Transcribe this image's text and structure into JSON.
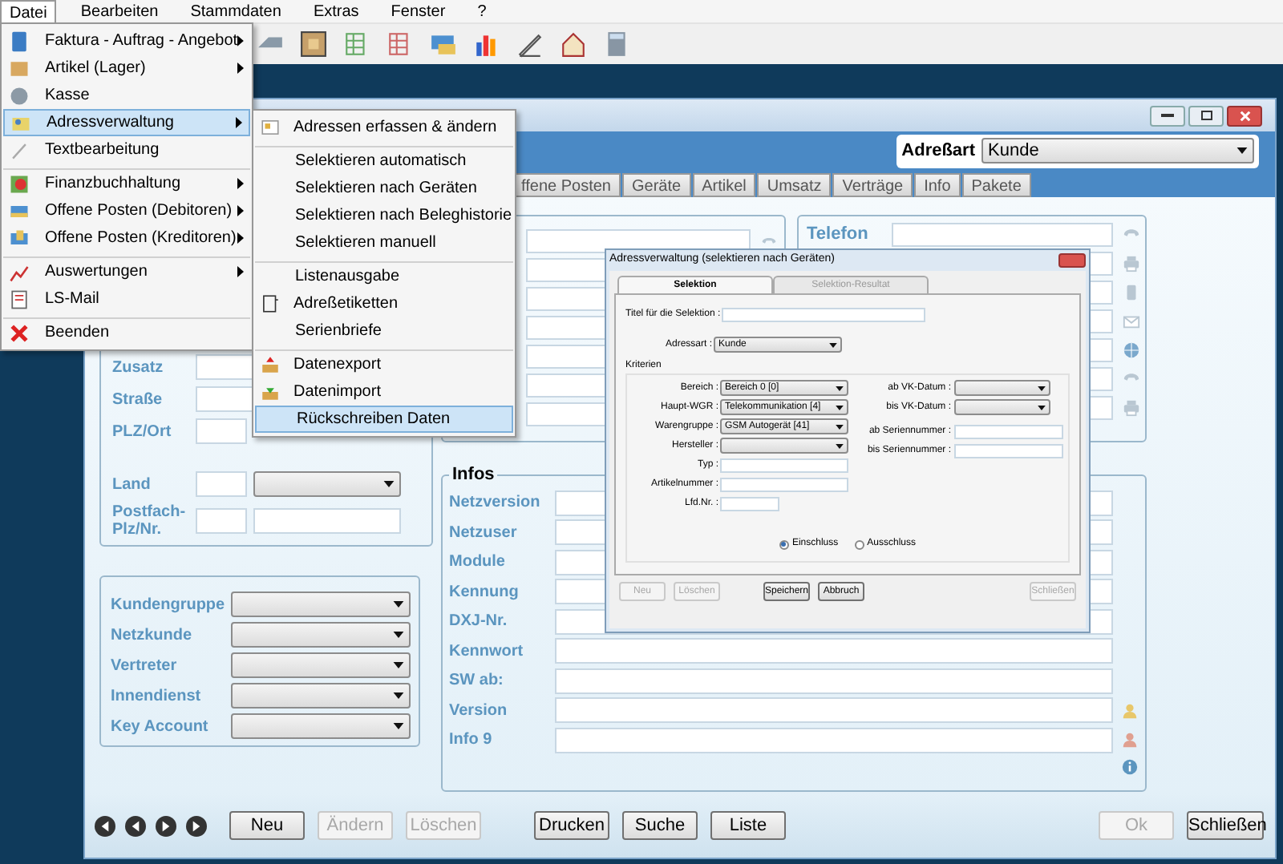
{
  "menubar": [
    {
      "label": "Datei",
      "selected": true
    },
    {
      "label": "Bearbeiten",
      "selected": false
    },
    {
      "label": "Stammdaten",
      "selected": false
    },
    {
      "label": "Extras",
      "selected": false
    },
    {
      "label": "Fenster",
      "selected": false
    },
    {
      "label": "?",
      "selected": false
    }
  ],
  "file_menu": [
    {
      "label": "Faktura - Auftrag - Angebot",
      "submenu": true,
      "selected": false,
      "separator_after": false
    },
    {
      "label": "Artikel (Lager)",
      "submenu": true,
      "selected": false,
      "separator_after": false
    },
    {
      "label": "Kasse",
      "submenu": false,
      "selected": false,
      "separator_after": false
    },
    {
      "label": "Adressverwaltung",
      "submenu": true,
      "selected": true,
      "separator_after": false
    },
    {
      "label": "Textbearbeitung",
      "submenu": false,
      "selected": false,
      "separator_after": true
    },
    {
      "label": "Finanzbuchhaltung",
      "submenu": true,
      "selected": false,
      "separator_after": false
    },
    {
      "label": "Offene Posten (Debitoren)",
      "submenu": true,
      "selected": false,
      "separator_after": false
    },
    {
      "label": "Offene Posten (Kreditoren)",
      "submenu": true,
      "selected": false,
      "separator_after": true
    },
    {
      "label": "Auswertungen",
      "submenu": true,
      "selected": false,
      "separator_after": false
    },
    {
      "label": "LS-Mail",
      "submenu": false,
      "selected": false,
      "separator_after": true
    },
    {
      "label": "Beenden",
      "submenu": false,
      "selected": false,
      "separator_after": false
    }
  ],
  "address_submenu": [
    {
      "label": "Adressen erfassen & ändern",
      "selected": false,
      "separator_after": true
    },
    {
      "label": "Selektieren automatisch",
      "selected": false,
      "separator_after": false
    },
    {
      "label": "Selektieren nach Geräten",
      "selected": false,
      "separator_after": false
    },
    {
      "label": "Selektieren nach Beleghistorie",
      "selected": false,
      "separator_after": false
    },
    {
      "label": "Selektieren manuell",
      "selected": false,
      "separator_after": true
    },
    {
      "label": "Listenausgabe",
      "selected": false,
      "separator_after": false
    },
    {
      "label": "Adreßetiketten",
      "selected": false,
      "separator_after": false
    },
    {
      "label": "Serienbriefe",
      "selected": false,
      "separator_after": true
    },
    {
      "label": "Datenexport",
      "selected": false,
      "separator_after": false
    },
    {
      "label": "Datenimport",
      "selected": false,
      "separator_after": false
    },
    {
      "label": "Rückschreiben Daten",
      "selected": true,
      "separator_after": false
    }
  ],
  "address_type": {
    "label": "Adreßart",
    "value": "Kunde"
  },
  "tabs": [
    {
      "label": "ffene Posten",
      "selected": false
    },
    {
      "label": "Geräte",
      "selected": false
    },
    {
      "label": "Artikel",
      "selected": false
    },
    {
      "label": "Umsatz",
      "selected": false
    },
    {
      "label": "Verträge",
      "selected": false
    },
    {
      "label": "Info",
      "selected": false
    },
    {
      "label": "Pakete",
      "selected": false
    }
  ],
  "address_panel": {
    "rows": [
      {
        "label": "Zusatz",
        "kind": "text"
      },
      {
        "label": "Straße",
        "kind": "text"
      },
      {
        "label": "PLZ/Ort",
        "kind": "zip"
      },
      {
        "label": "Land",
        "kind": "country"
      },
      {
        "label": "Postfach-Plz/Nr.",
        "kind": "zip"
      }
    ]
  },
  "contact_panel": {
    "label": "Telefon"
  },
  "classification": [
    {
      "label": "Kundengruppe"
    },
    {
      "label": "Netzkunde"
    },
    {
      "label": "Vertreter"
    },
    {
      "label": "Innendienst"
    },
    {
      "label": "Key Account"
    }
  ],
  "infos": {
    "title": "Infos",
    "rows": [
      "Netzversion",
      "Netzuser",
      "Module",
      "Kennung",
      "DXJ-Nr.",
      "Kennwort",
      "SW ab:",
      "Version",
      "Info 9"
    ]
  },
  "bottom_buttons": [
    {
      "label": "Neu",
      "disabled": false
    },
    {
      "label": "Ändern",
      "disabled": true
    },
    {
      "label": "Löschen",
      "disabled": true
    },
    {
      "label": "Drucken",
      "disabled": false
    },
    {
      "label": "Suche",
      "disabled": false
    },
    {
      "label": "Liste",
      "disabled": false
    },
    {
      "label": "Ok",
      "disabled": true
    },
    {
      "label": "Schließen",
      "disabled": false
    }
  ],
  "dialog": {
    "title": "Adressverwaltung (selektieren nach Geräten)",
    "tabs": [
      {
        "label": "Selektion",
        "selected": true
      },
      {
        "label": "Selektion-Resultat",
        "selected": false
      }
    ],
    "title_field": {
      "label": "Titel für die Selektion :"
    },
    "address_type": {
      "label": "Adressart :",
      "value": "Kunde"
    },
    "criteria_title": "Kriterien",
    "criteria_left": [
      {
        "label": "Bereich :",
        "kind": "dropdown",
        "value": "Bereich 0 [0]"
      },
      {
        "label": "Haupt-WGR :",
        "kind": "dropdown",
        "value": "Telekommunikation [4]"
      },
      {
        "label": "Warengruppe :",
        "kind": "dropdown",
        "value": "GSM Autogerät [41]"
      },
      {
        "label": "Hersteller :",
        "kind": "dropdown"
      },
      {
        "label": "Typ :",
        "kind": "text"
      },
      {
        "label": "Artikelnummer :",
        "kind": "text"
      },
      {
        "label": "Lfd.Nr. :",
        "kind": "short"
      }
    ],
    "criteria_right": [
      {
        "label": "ab VK-Datum :",
        "kind": "date"
      },
      {
        "label": "bis VK-Datum :",
        "kind": "date"
      },
      {
        "label": "ab Seriennummer :",
        "kind": "text"
      },
      {
        "label": "bis Seriennummer :",
        "kind": "text"
      }
    ],
    "radios": [
      {
        "label": "Einschluss",
        "selected": true
      },
      {
        "label": "Ausschluss",
        "selected": false
      }
    ],
    "buttons": [
      {
        "label": "Neu",
        "disabled": true
      },
      {
        "label": "Löschen",
        "disabled": true
      },
      {
        "label": "Speichern",
        "disabled": false
      },
      {
        "label": "Abbruch",
        "disabled": false
      },
      {
        "label": "Schließen",
        "disabled": true
      }
    ]
  }
}
